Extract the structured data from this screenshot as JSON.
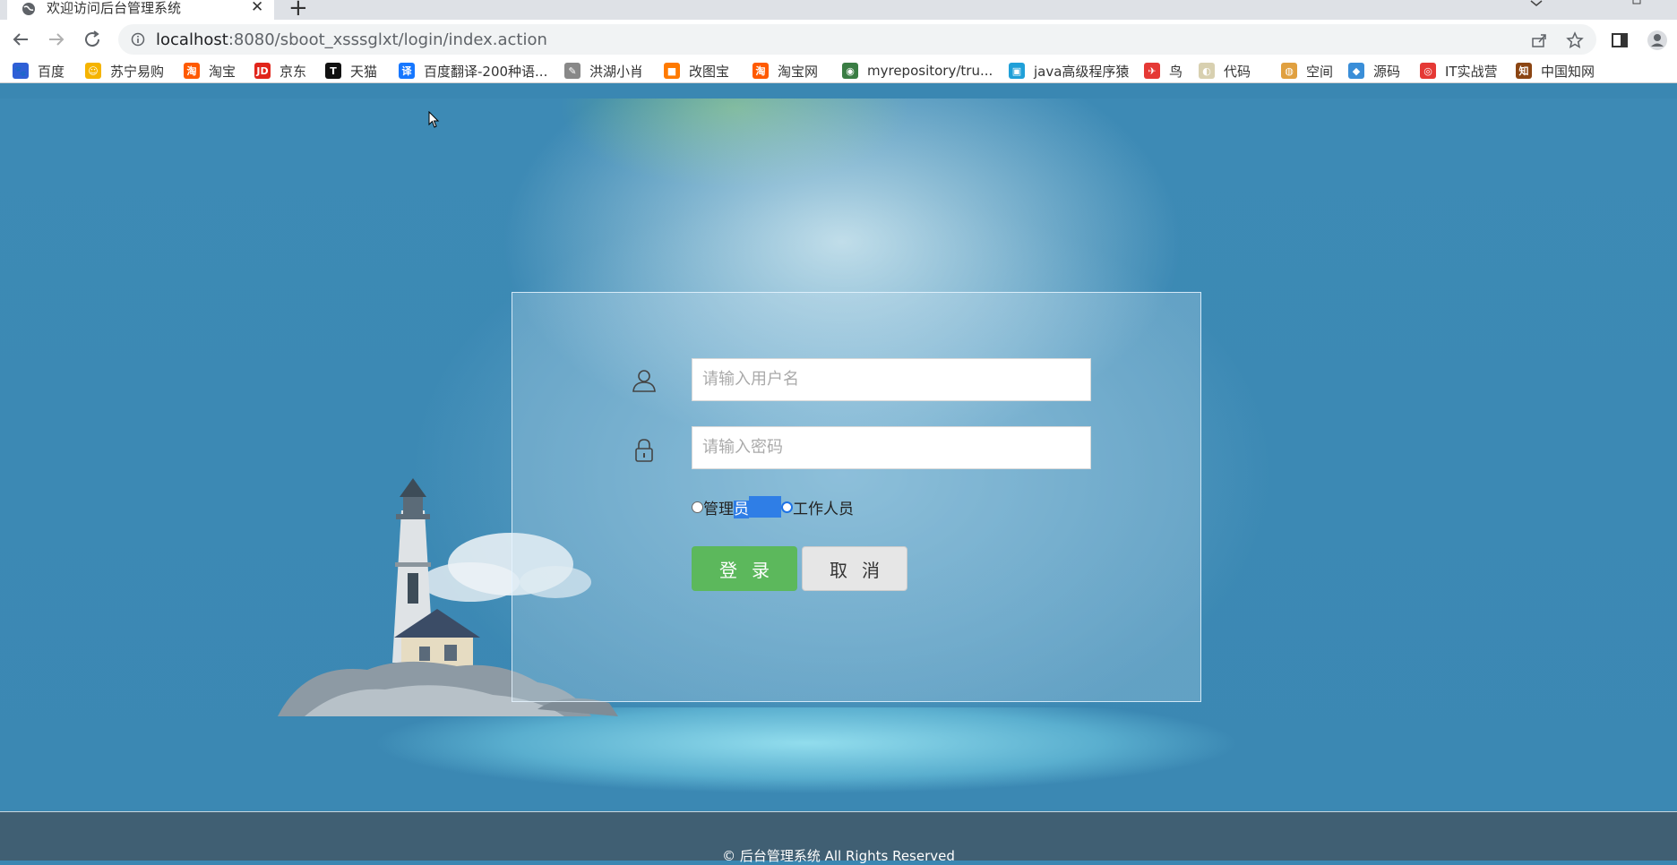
{
  "browser": {
    "tab_title": "欢迎访问后台管理系统",
    "tab_close": "✕",
    "new_tab": "+",
    "url_host": "localhost",
    "url_rest": ":8080/sboot_xsssglxt/login/index.action"
  },
  "bookmarks": [
    {
      "label": "百度",
      "icon": "baidu-icon",
      "color": "#2f5fd6",
      "glyph": "🐾"
    },
    {
      "label": "苏宁易购",
      "icon": "suning-icon",
      "color": "#f5b400",
      "glyph": "☺"
    },
    {
      "label": "淘宝",
      "icon": "taobao-icon",
      "color": "#ff5a00",
      "glyph": "淘"
    },
    {
      "label": "京东",
      "icon": "jd-icon",
      "color": "#e1251b",
      "glyph": "JD"
    },
    {
      "label": "天猫",
      "icon": "tmall-icon",
      "color": "#111111",
      "glyph": "T"
    },
    {
      "label": "百度翻译-200种语...",
      "icon": "translate-icon",
      "color": "#1677ff",
      "glyph": "译"
    },
    {
      "label": "洪湖小肖",
      "icon": "feather-icon",
      "color": "#888888",
      "glyph": "✎"
    },
    {
      "label": "改图宝",
      "icon": "gaitubao-icon",
      "color": "#ff7a00",
      "glyph": "■"
    },
    {
      "label": "淘宝网",
      "icon": "taobao-net-icon",
      "color": "#ff5a00",
      "glyph": "淘"
    },
    {
      "label": "myrepository/tru...",
      "icon": "chrome-icon",
      "color": "#3a7d44",
      "glyph": "◉"
    },
    {
      "label": "java高级程序猿",
      "icon": "bilibili-icon",
      "color": "#20a0d8",
      "glyph": "▣"
    },
    {
      "label": "鸟",
      "icon": "bird-icon",
      "color": "#e53935",
      "glyph": "✈"
    },
    {
      "label": "代码",
      "icon": "code-icon",
      "color": "#d8d0b0",
      "glyph": "◐"
    },
    {
      "label": "空间",
      "icon": "space-icon",
      "color": "#e0a040",
      "glyph": "◍"
    },
    {
      "label": "源码",
      "icon": "source-icon",
      "color": "#3a8ed8",
      "glyph": "◆"
    },
    {
      "label": "IT实战营",
      "icon": "it-icon",
      "color": "#e53935",
      "glyph": "◎"
    },
    {
      "label": "中国知网",
      "icon": "cnki-icon",
      "color": "#8b4513",
      "glyph": "知"
    }
  ],
  "login": {
    "username_placeholder": "请输入用户名",
    "password_placeholder": "请输入密码",
    "role_admin_part1": "管理",
    "role_admin_part2": "员",
    "role_staff": "工作人员",
    "login_button": "登录",
    "cancel_button": "取消"
  },
  "footer": {
    "text": "© 后台管理系统 All Rights Reserved"
  },
  "colors": {
    "login_button": "#5cb85c",
    "cancel_button": "#e6e6e6",
    "footer_bg": "#405f73",
    "page_bg": "#3a87b2"
  }
}
